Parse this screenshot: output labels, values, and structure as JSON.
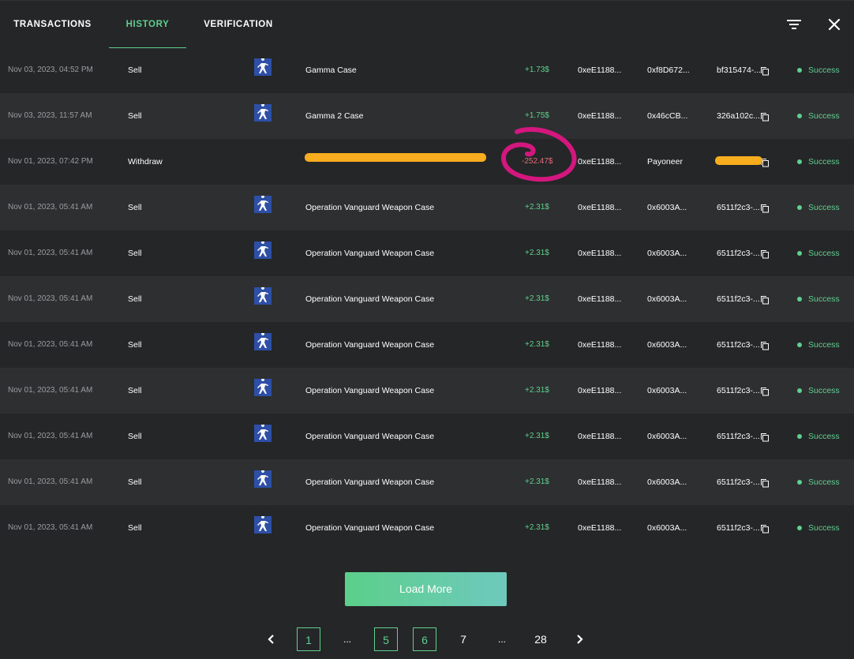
{
  "tabs": [
    {
      "label": "TRANSACTIONS"
    },
    {
      "label": "HISTORY"
    },
    {
      "label": "VERIFICATION"
    }
  ],
  "header_icons": {
    "filter": "filter-icon",
    "close": "close-icon"
  },
  "colors": {
    "accent": "#5fd08f",
    "negative": "#e66b78",
    "redaction": "#f7ad1e",
    "annotation": "#d4177f"
  },
  "rows": [
    {
      "date": "Nov 03, 2023, 04:52 PM",
      "type": "Sell",
      "item": "Gamma Case",
      "amount": "+1.73$",
      "from": "0xeE1188...",
      "to": "0xf8D672...",
      "tx": "bf315474-...",
      "status": "Success"
    },
    {
      "date": "Nov 03, 2023, 11:57 AM",
      "type": "Sell",
      "item": "Gamma 2 Case",
      "amount": "+1.75$",
      "from": "0xeE1188...",
      "to": "0x46cCB...",
      "tx": "326a102c...",
      "status": "Success"
    },
    {
      "date": "Nov 01, 2023, 07:42 PM",
      "type": "Withdraw",
      "item": "",
      "amount": "-252.47$",
      "from": "0xeE1188...",
      "to": "Payoneer",
      "tx": "",
      "status": "Success"
    },
    {
      "date": "Nov 01, 2023, 05:41 AM",
      "type": "Sell",
      "item": "Operation Vanguard Weapon Case",
      "amount": "+2.31$",
      "from": "0xeE1188...",
      "to": "0x6003A...",
      "tx": "6511f2c3-...",
      "status": "Success"
    },
    {
      "date": "Nov 01, 2023, 05:41 AM",
      "type": "Sell",
      "item": "Operation Vanguard Weapon Case",
      "amount": "+2.31$",
      "from": "0xeE1188...",
      "to": "0x6003A...",
      "tx": "6511f2c3-...",
      "status": "Success"
    },
    {
      "date": "Nov 01, 2023, 05:41 AM",
      "type": "Sell",
      "item": "Operation Vanguard Weapon Case",
      "amount": "+2.31$",
      "from": "0xeE1188...",
      "to": "0x6003A...",
      "tx": "6511f2c3-...",
      "status": "Success"
    },
    {
      "date": "Nov 01, 2023, 05:41 AM",
      "type": "Sell",
      "item": "Operation Vanguard Weapon Case",
      "amount": "+2.31$",
      "from": "0xeE1188...",
      "to": "0x6003A...",
      "tx": "6511f2c3-...",
      "status": "Success"
    },
    {
      "date": "Nov 01, 2023, 05:41 AM",
      "type": "Sell",
      "item": "Operation Vanguard Weapon Case",
      "amount": "+2.31$",
      "from": "0xeE1188...",
      "to": "0x6003A...",
      "tx": "6511f2c3-...",
      "status": "Success"
    },
    {
      "date": "Nov 01, 2023, 05:41 AM",
      "type": "Sell",
      "item": "Operation Vanguard Weapon Case",
      "amount": "+2.31$",
      "from": "0xeE1188...",
      "to": "0x6003A...",
      "tx": "6511f2c3-...",
      "status": "Success"
    },
    {
      "date": "Nov 01, 2023, 05:41 AM",
      "type": "Sell",
      "item": "Operation Vanguard Weapon Case",
      "amount": "+2.31$",
      "from": "0xeE1188...",
      "to": "0x6003A...",
      "tx": "6511f2c3-...",
      "status": "Success"
    },
    {
      "date": "Nov 01, 2023, 05:41 AM",
      "type": "Sell",
      "item": "Operation Vanguard Weapon Case",
      "amount": "+2.31$",
      "from": "0xeE1188...",
      "to": "0x6003A...",
      "tx": "6511f2c3-...",
      "status": "Success"
    }
  ],
  "load_more_label": "Load More",
  "pagination": {
    "prev": "‹",
    "next": "›",
    "items": [
      "1",
      "...",
      "5",
      "6",
      "7",
      "...",
      "28"
    ]
  }
}
